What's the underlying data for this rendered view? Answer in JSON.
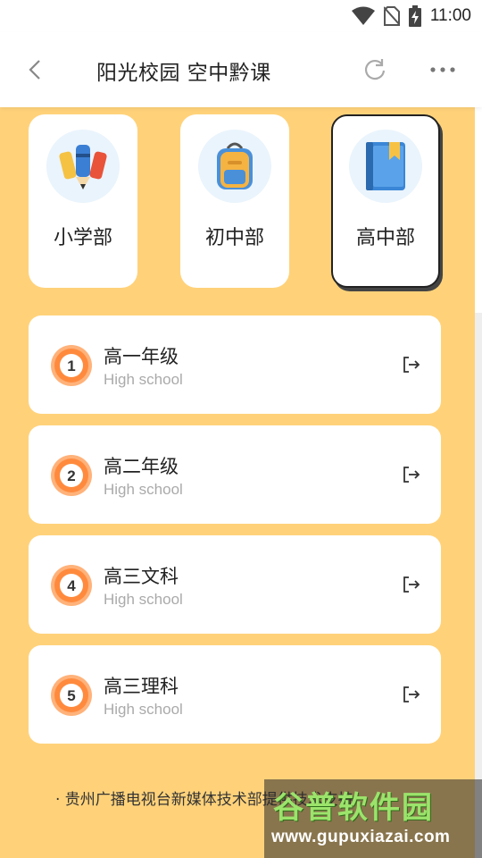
{
  "status_bar": {
    "time": "11:00",
    "icons": [
      "wifi-icon",
      "no-sim-icon",
      "battery-charging-icon"
    ]
  },
  "app_bar": {
    "title": "阳光校园 空中黔课",
    "icons": [
      "back-arrow-icon",
      "refresh-icon",
      "more-dots-icon"
    ]
  },
  "categories": [
    {
      "label": "小学部",
      "icon": "pencils-icon",
      "active": false
    },
    {
      "label": "初中部",
      "icon": "backpack-icon",
      "active": false
    },
    {
      "label": "高中部",
      "icon": "book-icon",
      "active": true
    }
  ],
  "grades": [
    {
      "number": "1",
      "title": "高一年级",
      "subtitle": "High school"
    },
    {
      "number": "2",
      "title": "高二年级",
      "subtitle": "High school"
    },
    {
      "number": "4",
      "title": "高三文科",
      "subtitle": "High school"
    },
    {
      "number": "5",
      "title": "高三理科",
      "subtitle": "High school"
    }
  ],
  "footer": {
    "text": "· 贵州广播电视台新媒体技术部提供技术支持"
  },
  "watermark": {
    "title": "谷普软件园",
    "url": "www.gupuxiazai.com"
  },
  "colors": {
    "background": "#ffd27a",
    "badge": "#ff8a3d",
    "card": "#ffffff"
  }
}
